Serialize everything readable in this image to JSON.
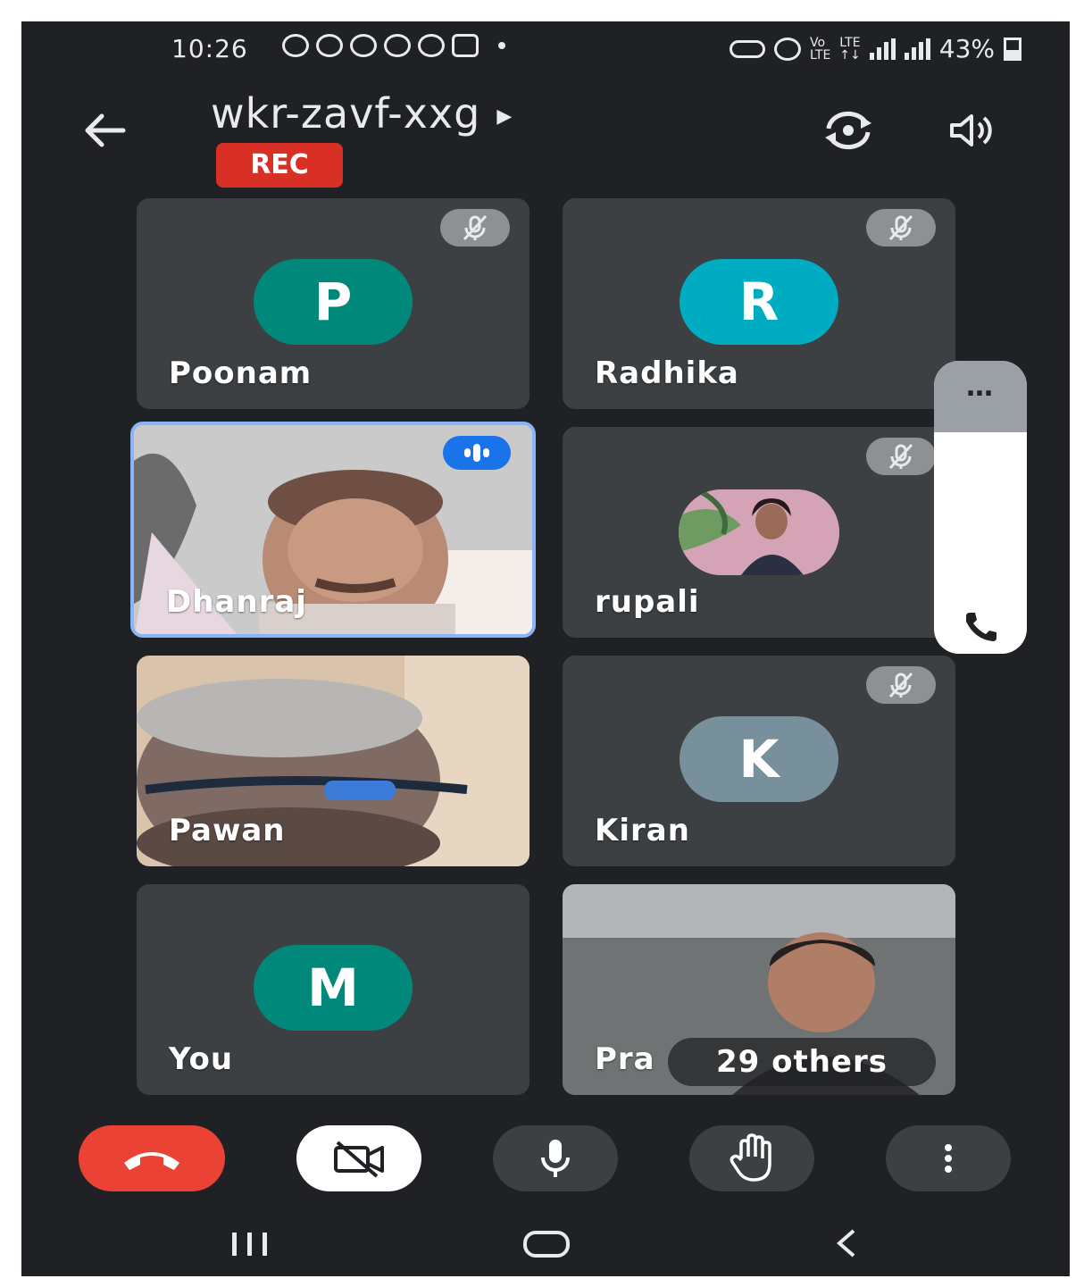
{
  "status_bar": {
    "time": "10:26",
    "battery": "43%",
    "icons": [
      "whatsapp-icon",
      "app-icon",
      "app-icon",
      "cloud-icon",
      "cloud-icon",
      "gallery-icon",
      "dot-icon",
      "key-icon",
      "alarm-icon",
      "volte-icon",
      "lte-icon",
      "signal-icon",
      "signal-icon",
      "battery-icon"
    ]
  },
  "header": {
    "meeting_code": "wkr-zavf-xxg",
    "recording_label": "REC",
    "back_icon": "arrow-left-icon",
    "camera_switch_icon": "camera-switch-icon",
    "speaker_icon": "speaker-icon"
  },
  "participants": [
    {
      "name": "Poonam",
      "initial": "P",
      "type": "avatar",
      "color": "#00897b",
      "muted": true
    },
    {
      "name": "Radhika",
      "initial": "R",
      "type": "avatar",
      "color": "#00acc1",
      "muted": true
    },
    {
      "name": "Dhanraj",
      "type": "video",
      "speaking": true
    },
    {
      "name": "rupali",
      "type": "photo",
      "muted": true
    },
    {
      "name": "Pawan",
      "type": "video"
    },
    {
      "name": "Kiran",
      "initial": "K",
      "type": "avatar",
      "color": "#78909c",
      "muted": true
    },
    {
      "name": "You",
      "initial": "M",
      "type": "avatar",
      "color": "#00897b"
    },
    {
      "name": "Pra",
      "type": "video",
      "overflow_label": "29 others"
    }
  ],
  "side_panel": {
    "more_label": "…",
    "icon": "phone-icon"
  },
  "controls": [
    "end-call-button",
    "camera-off-button",
    "mic-button",
    "raise-hand-button",
    "more-options-button"
  ],
  "colors": {
    "end_call": "#ea4335",
    "speaking_border": "#8ab4f8",
    "rec": "#d93025"
  }
}
